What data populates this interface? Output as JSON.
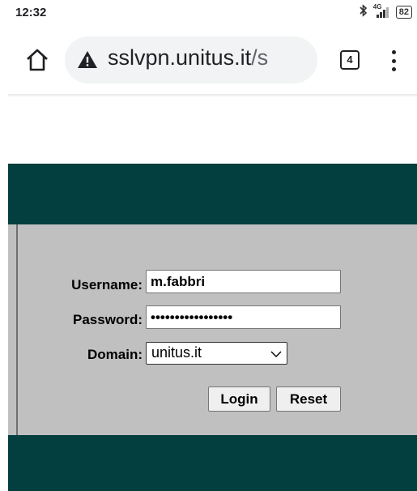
{
  "status_bar": {
    "time": "12:32",
    "network_label": "4G",
    "battery": "82",
    "icons": [
      "bluetooth-icon",
      "signal-icon",
      "battery-icon"
    ]
  },
  "browser": {
    "url_main": "sslvpn.unitus.it",
    "url_rest": "/s",
    "tab_count": "4",
    "icons": [
      "home-icon",
      "not-secure-warning-icon",
      "tab-switcher-icon",
      "more-menu-icon"
    ]
  },
  "login_form": {
    "username_label": "Username:",
    "username_value": "m.fabbri",
    "password_label": "Password:",
    "password_value": "•••••••••••••••••",
    "domain_label": "Domain:",
    "domain_value": "unitus.it",
    "login_label": "Login",
    "reset_label": "Reset"
  },
  "colors": {
    "band": "#023f3e",
    "panel": "#c0c0c0",
    "pill": "#f1f3f4"
  }
}
